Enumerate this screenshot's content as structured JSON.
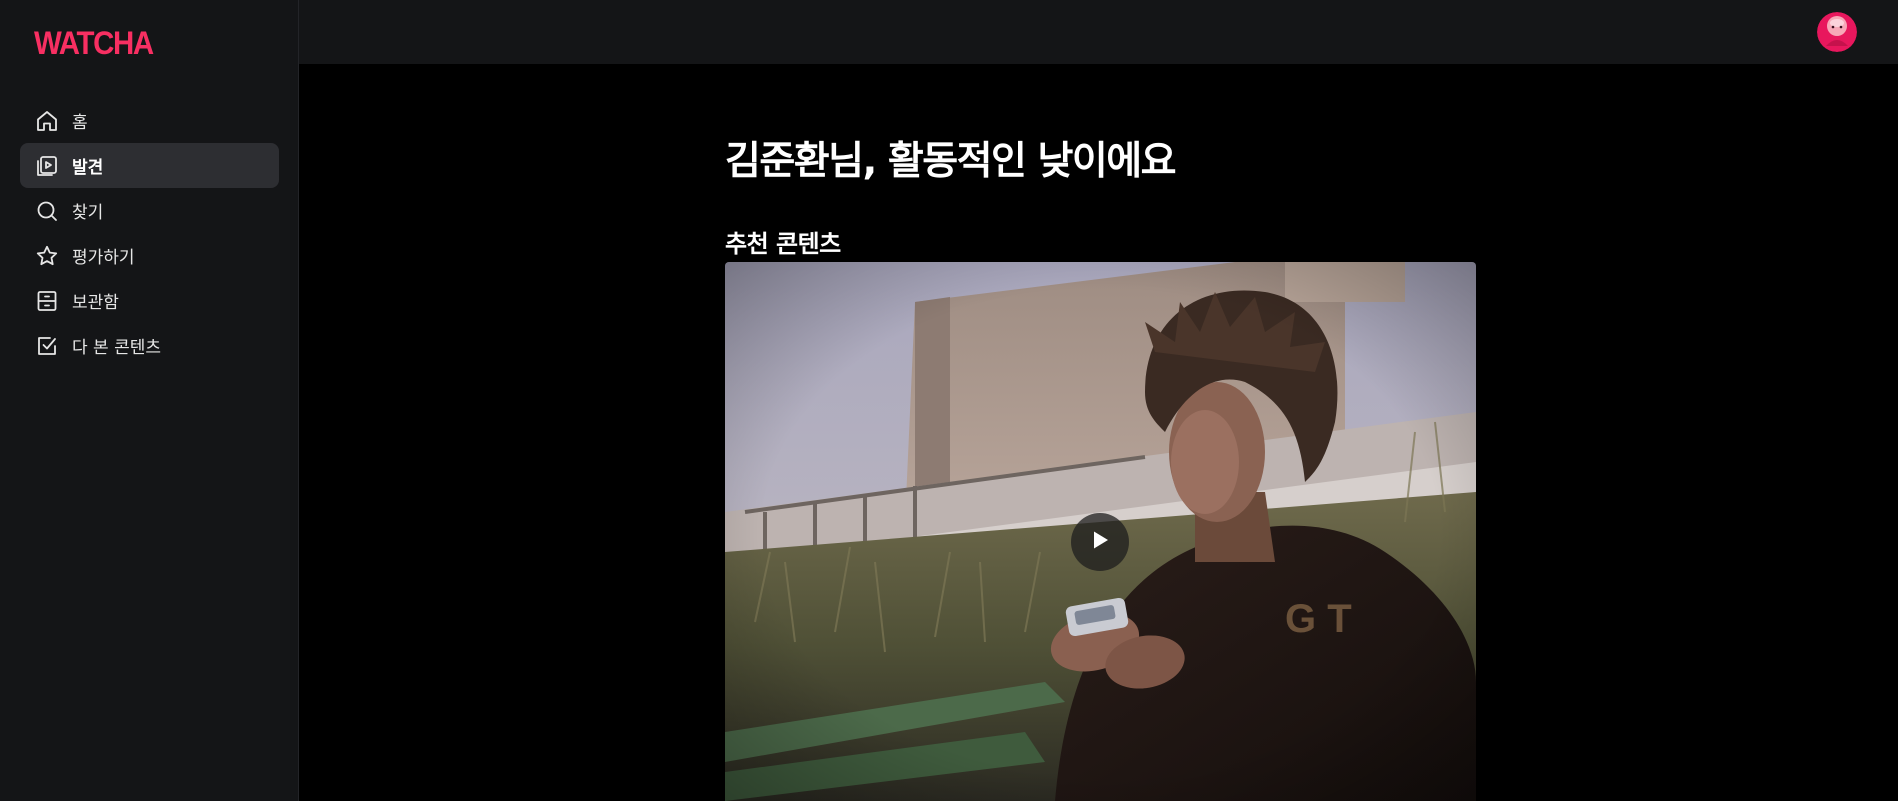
{
  "app": {
    "logo_text": "WATCHA",
    "brand_color": "#f82f62"
  },
  "sidebar": {
    "items": [
      {
        "label": "홈",
        "icon": "home-icon",
        "active": false
      },
      {
        "label": "발견",
        "icon": "discover-icon",
        "active": true
      },
      {
        "label": "찾기",
        "icon": "search-icon",
        "active": false
      },
      {
        "label": "평가하기",
        "icon": "star-icon",
        "active": false
      },
      {
        "label": "보관함",
        "icon": "storage-icon",
        "active": false
      },
      {
        "label": "다 본 콘텐츠",
        "icon": "checkbox-icon",
        "active": false
      }
    ]
  },
  "header": {
    "avatar_icon": "profile-avatar"
  },
  "main": {
    "greeting": "김준환님, 활동적인 낮이에요",
    "section_title": "추천 콘텐츠",
    "featured": {
      "play_icon": "play-icon"
    }
  }
}
